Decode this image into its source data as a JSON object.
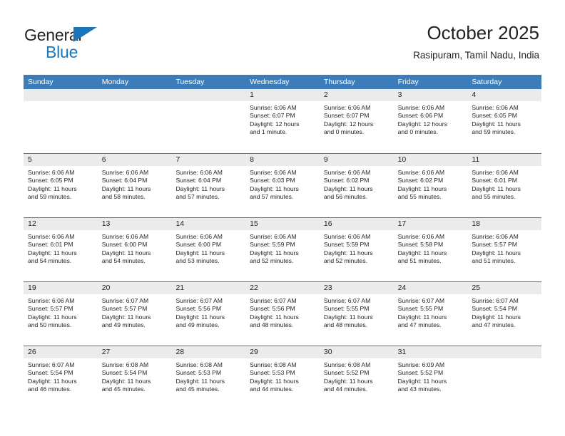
{
  "brand": {
    "name_top": "General",
    "name_bottom": "Blue",
    "accent_color": "#1b75bb"
  },
  "header": {
    "title": "October 2025",
    "location": "Rasipuram, Tamil Nadu, India"
  },
  "theme": {
    "header_bar_color": "#3c7cb8",
    "day_number_band_color": "#ebebeb",
    "text_color": "#231f20"
  },
  "weekday_headers": [
    "Sunday",
    "Monday",
    "Tuesday",
    "Wednesday",
    "Thursday",
    "Friday",
    "Saturday"
  ],
  "weeks": [
    [
      {
        "date": "",
        "sunrise": "",
        "sunset": "",
        "daylight_line1": "",
        "daylight_line2": ""
      },
      {
        "date": "",
        "sunrise": "",
        "sunset": "",
        "daylight_line1": "",
        "daylight_line2": ""
      },
      {
        "date": "",
        "sunrise": "",
        "sunset": "",
        "daylight_line1": "",
        "daylight_line2": ""
      },
      {
        "date": "1",
        "sunrise": "Sunrise: 6:06 AM",
        "sunset": "Sunset: 6:07 PM",
        "daylight_line1": "Daylight: 12 hours",
        "daylight_line2": "and 1 minute."
      },
      {
        "date": "2",
        "sunrise": "Sunrise: 6:06 AM",
        "sunset": "Sunset: 6:07 PM",
        "daylight_line1": "Daylight: 12 hours",
        "daylight_line2": "and 0 minutes."
      },
      {
        "date": "3",
        "sunrise": "Sunrise: 6:06 AM",
        "sunset": "Sunset: 6:06 PM",
        "daylight_line1": "Daylight: 12 hours",
        "daylight_line2": "and 0 minutes."
      },
      {
        "date": "4",
        "sunrise": "Sunrise: 6:06 AM",
        "sunset": "Sunset: 6:05 PM",
        "daylight_line1": "Daylight: 11 hours",
        "daylight_line2": "and 59 minutes."
      }
    ],
    [
      {
        "date": "5",
        "sunrise": "Sunrise: 6:06 AM",
        "sunset": "Sunset: 6:05 PM",
        "daylight_line1": "Daylight: 11 hours",
        "daylight_line2": "and 59 minutes."
      },
      {
        "date": "6",
        "sunrise": "Sunrise: 6:06 AM",
        "sunset": "Sunset: 6:04 PM",
        "daylight_line1": "Daylight: 11 hours",
        "daylight_line2": "and 58 minutes."
      },
      {
        "date": "7",
        "sunrise": "Sunrise: 6:06 AM",
        "sunset": "Sunset: 6:04 PM",
        "daylight_line1": "Daylight: 11 hours",
        "daylight_line2": "and 57 minutes."
      },
      {
        "date": "8",
        "sunrise": "Sunrise: 6:06 AM",
        "sunset": "Sunset: 6:03 PM",
        "daylight_line1": "Daylight: 11 hours",
        "daylight_line2": "and 57 minutes."
      },
      {
        "date": "9",
        "sunrise": "Sunrise: 6:06 AM",
        "sunset": "Sunset: 6:02 PM",
        "daylight_line1": "Daylight: 11 hours",
        "daylight_line2": "and 56 minutes."
      },
      {
        "date": "10",
        "sunrise": "Sunrise: 6:06 AM",
        "sunset": "Sunset: 6:02 PM",
        "daylight_line1": "Daylight: 11 hours",
        "daylight_line2": "and 55 minutes."
      },
      {
        "date": "11",
        "sunrise": "Sunrise: 6:06 AM",
        "sunset": "Sunset: 6:01 PM",
        "daylight_line1": "Daylight: 11 hours",
        "daylight_line2": "and 55 minutes."
      }
    ],
    [
      {
        "date": "12",
        "sunrise": "Sunrise: 6:06 AM",
        "sunset": "Sunset: 6:01 PM",
        "daylight_line1": "Daylight: 11 hours",
        "daylight_line2": "and 54 minutes."
      },
      {
        "date": "13",
        "sunrise": "Sunrise: 6:06 AM",
        "sunset": "Sunset: 6:00 PM",
        "daylight_line1": "Daylight: 11 hours",
        "daylight_line2": "and 54 minutes."
      },
      {
        "date": "14",
        "sunrise": "Sunrise: 6:06 AM",
        "sunset": "Sunset: 6:00 PM",
        "daylight_line1": "Daylight: 11 hours",
        "daylight_line2": "and 53 minutes."
      },
      {
        "date": "15",
        "sunrise": "Sunrise: 6:06 AM",
        "sunset": "Sunset: 5:59 PM",
        "daylight_line1": "Daylight: 11 hours",
        "daylight_line2": "and 52 minutes."
      },
      {
        "date": "16",
        "sunrise": "Sunrise: 6:06 AM",
        "sunset": "Sunset: 5:59 PM",
        "daylight_line1": "Daylight: 11 hours",
        "daylight_line2": "and 52 minutes."
      },
      {
        "date": "17",
        "sunrise": "Sunrise: 6:06 AM",
        "sunset": "Sunset: 5:58 PM",
        "daylight_line1": "Daylight: 11 hours",
        "daylight_line2": "and 51 minutes."
      },
      {
        "date": "18",
        "sunrise": "Sunrise: 6:06 AM",
        "sunset": "Sunset: 5:57 PM",
        "daylight_line1": "Daylight: 11 hours",
        "daylight_line2": "and 51 minutes."
      }
    ],
    [
      {
        "date": "19",
        "sunrise": "Sunrise: 6:06 AM",
        "sunset": "Sunset: 5:57 PM",
        "daylight_line1": "Daylight: 11 hours",
        "daylight_line2": "and 50 minutes."
      },
      {
        "date": "20",
        "sunrise": "Sunrise: 6:07 AM",
        "sunset": "Sunset: 5:57 PM",
        "daylight_line1": "Daylight: 11 hours",
        "daylight_line2": "and 49 minutes."
      },
      {
        "date": "21",
        "sunrise": "Sunrise: 6:07 AM",
        "sunset": "Sunset: 5:56 PM",
        "daylight_line1": "Daylight: 11 hours",
        "daylight_line2": "and 49 minutes."
      },
      {
        "date": "22",
        "sunrise": "Sunrise: 6:07 AM",
        "sunset": "Sunset: 5:56 PM",
        "daylight_line1": "Daylight: 11 hours",
        "daylight_line2": "and 48 minutes."
      },
      {
        "date": "23",
        "sunrise": "Sunrise: 6:07 AM",
        "sunset": "Sunset: 5:55 PM",
        "daylight_line1": "Daylight: 11 hours",
        "daylight_line2": "and 48 minutes."
      },
      {
        "date": "24",
        "sunrise": "Sunrise: 6:07 AM",
        "sunset": "Sunset: 5:55 PM",
        "daylight_line1": "Daylight: 11 hours",
        "daylight_line2": "and 47 minutes."
      },
      {
        "date": "25",
        "sunrise": "Sunrise: 6:07 AM",
        "sunset": "Sunset: 5:54 PM",
        "daylight_line1": "Daylight: 11 hours",
        "daylight_line2": "and 47 minutes."
      }
    ],
    [
      {
        "date": "26",
        "sunrise": "Sunrise: 6:07 AM",
        "sunset": "Sunset: 5:54 PM",
        "daylight_line1": "Daylight: 11 hours",
        "daylight_line2": "and 46 minutes."
      },
      {
        "date": "27",
        "sunrise": "Sunrise: 6:08 AM",
        "sunset": "Sunset: 5:54 PM",
        "daylight_line1": "Daylight: 11 hours",
        "daylight_line2": "and 45 minutes."
      },
      {
        "date": "28",
        "sunrise": "Sunrise: 6:08 AM",
        "sunset": "Sunset: 5:53 PM",
        "daylight_line1": "Daylight: 11 hours",
        "daylight_line2": "and 45 minutes."
      },
      {
        "date": "29",
        "sunrise": "Sunrise: 6:08 AM",
        "sunset": "Sunset: 5:53 PM",
        "daylight_line1": "Daylight: 11 hours",
        "daylight_line2": "and 44 minutes."
      },
      {
        "date": "30",
        "sunrise": "Sunrise: 6:08 AM",
        "sunset": "Sunset: 5:52 PM",
        "daylight_line1": "Daylight: 11 hours",
        "daylight_line2": "and 44 minutes."
      },
      {
        "date": "31",
        "sunrise": "Sunrise: 6:09 AM",
        "sunset": "Sunset: 5:52 PM",
        "daylight_line1": "Daylight: 11 hours",
        "daylight_line2": "and 43 minutes."
      },
      {
        "date": "",
        "sunrise": "",
        "sunset": "",
        "daylight_line1": "",
        "daylight_line2": ""
      }
    ]
  ]
}
